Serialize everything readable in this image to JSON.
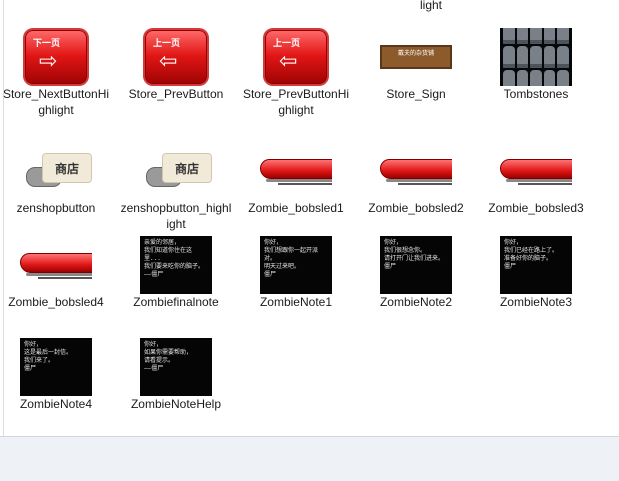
{
  "top_label": "light",
  "items": [
    {
      "label": "Store_NextButtonHighlight",
      "type": "button",
      "button_text": "下一页",
      "arrow": "⇨"
    },
    {
      "label": "Store_PrevButton",
      "type": "button",
      "button_text": "上一页",
      "arrow": "⇦"
    },
    {
      "label": "Store_PrevButtonHighlight",
      "type": "button",
      "button_text": "上一页",
      "arrow": "⇦"
    },
    {
      "label": "Store_Sign",
      "type": "sign",
      "sign_text": "戴夫的杂货铺"
    },
    {
      "label": "Tombstones",
      "type": "tombstones"
    },
    {
      "label": "zenshopbutton",
      "type": "shop",
      "shop_text": "商店"
    },
    {
      "label": "zenshopbutton_highlight",
      "type": "shop",
      "shop_text": "商店"
    },
    {
      "label": "Zombie_bobsled1",
      "type": "bobsled"
    },
    {
      "label": "Zombie_bobsled2",
      "type": "bobsled"
    },
    {
      "label": "Zombie_bobsled3",
      "type": "bobsled"
    },
    {
      "label": "Zombie_bobsled4",
      "type": "bobsled"
    },
    {
      "label": "Zombiefinalnote",
      "type": "note",
      "note_text": "亲爱的邻居，\n我们知道你住在这里...\n我们要来吃你的脑子。\n——僵尸"
    },
    {
      "label": "ZombieNote1",
      "type": "note",
      "note_text": "你好，\n我们想跟你一起开派对。\n明天过来吧。\n僵尸"
    },
    {
      "label": "ZombieNote2",
      "type": "note",
      "note_text": "你好，\n我们很想念你。\n请打开门让我们进来。\n僵尸"
    },
    {
      "label": "ZombieNote3",
      "type": "note",
      "note_text": "你好，\n我们已经在路上了。\n准备好你的脑子。\n僵尸"
    },
    {
      "label": "ZombieNote4",
      "type": "note",
      "note_text": "你好，\n这是最后一封信。\n我们来了。\n僵尸"
    },
    {
      "label": "ZombieNoteHelp",
      "type": "note",
      "note_text": "你好，\n如果你需要帮助，\n请看提示。\n——僵尸"
    }
  ],
  "colors": {
    "divider": "#d9dde4",
    "bottom_bar": "#eef1f6",
    "label_text": "#1b1b1b"
  }
}
